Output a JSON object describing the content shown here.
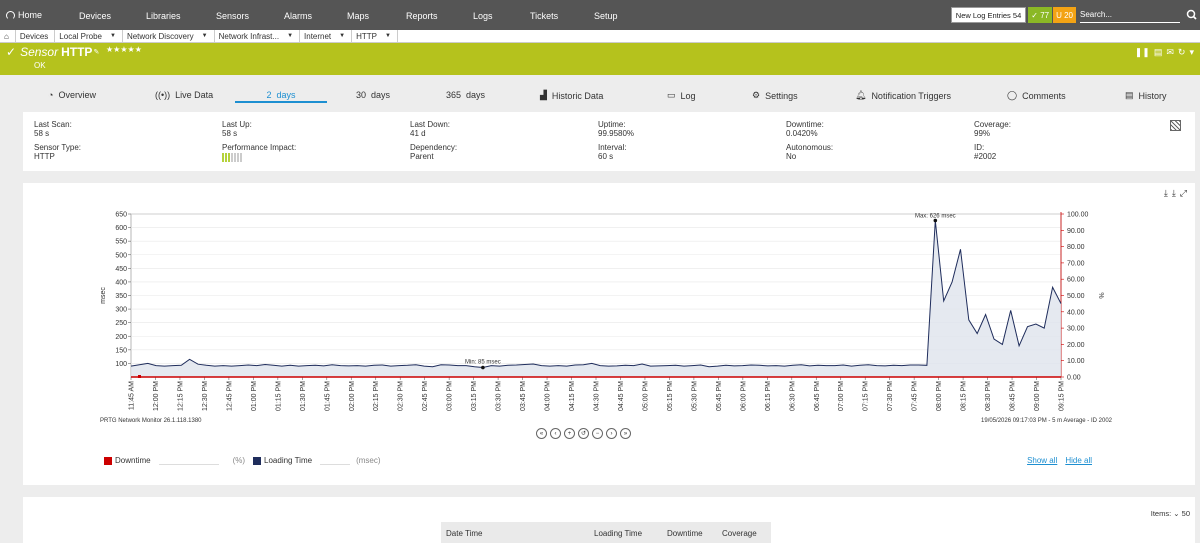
{
  "topnav": {
    "home": "Home",
    "items": [
      "Devices",
      "Libraries",
      "Sensors",
      "Alarms",
      "Maps",
      "Reports",
      "Logs",
      "Tickets",
      "Setup"
    ],
    "new_log_label": "New Log Entries",
    "new_log_count": "54",
    "ok_count": "77",
    "warn_count": "20",
    "search_placeholder": "Search..."
  },
  "breadcrumb": [
    "Devices",
    "Local Probe",
    "Network Discovery",
    "Network Infrast...",
    "Internet",
    "HTTP"
  ],
  "sensor": {
    "prefix": "Sensor",
    "name": "HTTP",
    "stars": "★★★★★",
    "status": "OK"
  },
  "tabs": [
    "Overview",
    "Live Data",
    "2  days",
    "30  days",
    "365  days",
    "Historic Data",
    "Log",
    "Settings",
    "Notification Triggers",
    "Comments",
    "History"
  ],
  "info": {
    "last_scan_label": "Last Scan:",
    "last_scan": "58 s",
    "last_up_label": "Last Up:",
    "last_up": "58 s",
    "last_down_label": "Last Down:",
    "last_down": "41 d",
    "uptime_label": "Uptime:",
    "uptime": "99.9580%",
    "downtime_label": "Downtime:",
    "downtime": "0.0420%",
    "coverage_label": "Coverage:",
    "coverage": "99%",
    "sensor_type_label": "Sensor Type:",
    "sensor_type": "HTTP",
    "perf_label": "Performance Impact:",
    "dependency_label": "Dependency:",
    "dependency": "Parent",
    "interval_label": "Interval:",
    "interval": "60 s",
    "autonomous_label": "Autonomous:",
    "autonomous": "No",
    "id_label": "ID:",
    "id": "#2002"
  },
  "chart_data": {
    "type": "line",
    "ylabel": "msec",
    "y2label": "%",
    "ylim": [
      50,
      650
    ],
    "y2lim": [
      0,
      100
    ],
    "yticks": [
      "650",
      "600",
      "550",
      "500",
      "450",
      "400",
      "350",
      "300",
      "250",
      "200",
      "150",
      "100"
    ],
    "y2ticks": [
      "100.00",
      "90.00",
      "80.00",
      "70.00",
      "60.00",
      "50.00",
      "40.00",
      "30.00",
      "20.00",
      "10.00",
      "0.00"
    ],
    "xticks": [
      "11:45 AM",
      "12:00 PM",
      "12:15 PM",
      "12:30 PM",
      "12:45 PM",
      "01:00 PM",
      "01:15 PM",
      "01:30 PM",
      "01:45 PM",
      "02:00 PM",
      "02:15 PM",
      "02:30 PM",
      "02:45 PM",
      "03:00 PM",
      "03:15 PM",
      "03:30 PM",
      "03:45 PM",
      "04:00 PM",
      "04:15 PM",
      "04:30 PM",
      "04:45 PM",
      "05:00 PM",
      "05:15 PM",
      "05:30 PM",
      "05:45 PM",
      "06:00 PM",
      "06:15 PM",
      "06:30 PM",
      "06:45 PM",
      "07:00 PM",
      "07:15 PM",
      "07:30 PM",
      "07:45 PM",
      "08:00 PM",
      "08:15 PM",
      "08:30 PM",
      "08:45 PM",
      "09:00 PM",
      "09:15 PM"
    ],
    "series": [
      {
        "name": "Loading Time",
        "unit": "msec",
        "color": "#1f2d5c",
        "values": [
          90,
          95,
          100,
          92,
          90,
          92,
          93,
          115,
          97,
          93,
          90,
          92,
          90,
          92,
          94,
          92,
          96,
          93,
          90,
          93,
          90,
          92,
          93,
          91,
          95,
          92,
          91,
          92,
          90,
          93,
          94,
          90,
          92,
          93,
          95,
          90,
          88,
          95,
          94,
          92,
          92,
          88,
          85,
          92,
          90,
          93,
          94,
          96,
          98,
          92,
          90,
          92,
          90,
          94,
          95,
          100,
          92,
          90,
          91,
          93,
          92,
          98,
          90,
          91,
          92,
          93,
          90,
          92,
          94,
          88,
          90,
          93,
          91,
          92,
          94,
          93,
          91,
          92,
          90,
          93,
          95,
          91,
          93,
          92,
          92,
          94,
          90,
          93,
          95,
          92,
          91,
          93,
          92,
          94,
          94,
          93,
          626,
          330,
          400,
          520,
          260,
          210,
          280,
          190,
          170,
          295,
          165,
          235,
          245,
          230,
          380,
          320
        ]
      },
      {
        "name": "Downtime",
        "unit": "%",
        "color": "#cc0000",
        "values": [
          0
        ]
      }
    ],
    "annotations": {
      "max": "Max: 626 msec",
      "min": "Min: 85 msec"
    },
    "footer_left": "PRTG Network Monitor 26.1.118.1380",
    "footer_right": "19/05/2026 09:17:03 PM - 5 m Average - ID 2002",
    "legend": [
      {
        "name": "Downtime",
        "unit": "(%)",
        "color": "#cc0000"
      },
      {
        "name": "Loading Time",
        "unit": "(msec)",
        "color": "#1f2d5c"
      }
    ]
  },
  "graph_links": {
    "show_all": "Show all",
    "hide_all": "Hide all"
  },
  "table": {
    "items_label": "Items:",
    "items_value": "50",
    "columns": [
      "Date Time",
      "Loading Time",
      "Downtime",
      "Coverage"
    ]
  },
  "colors": {
    "accent": "#b5c21d",
    "nav": "#555555",
    "link": "#1d8fd1"
  }
}
